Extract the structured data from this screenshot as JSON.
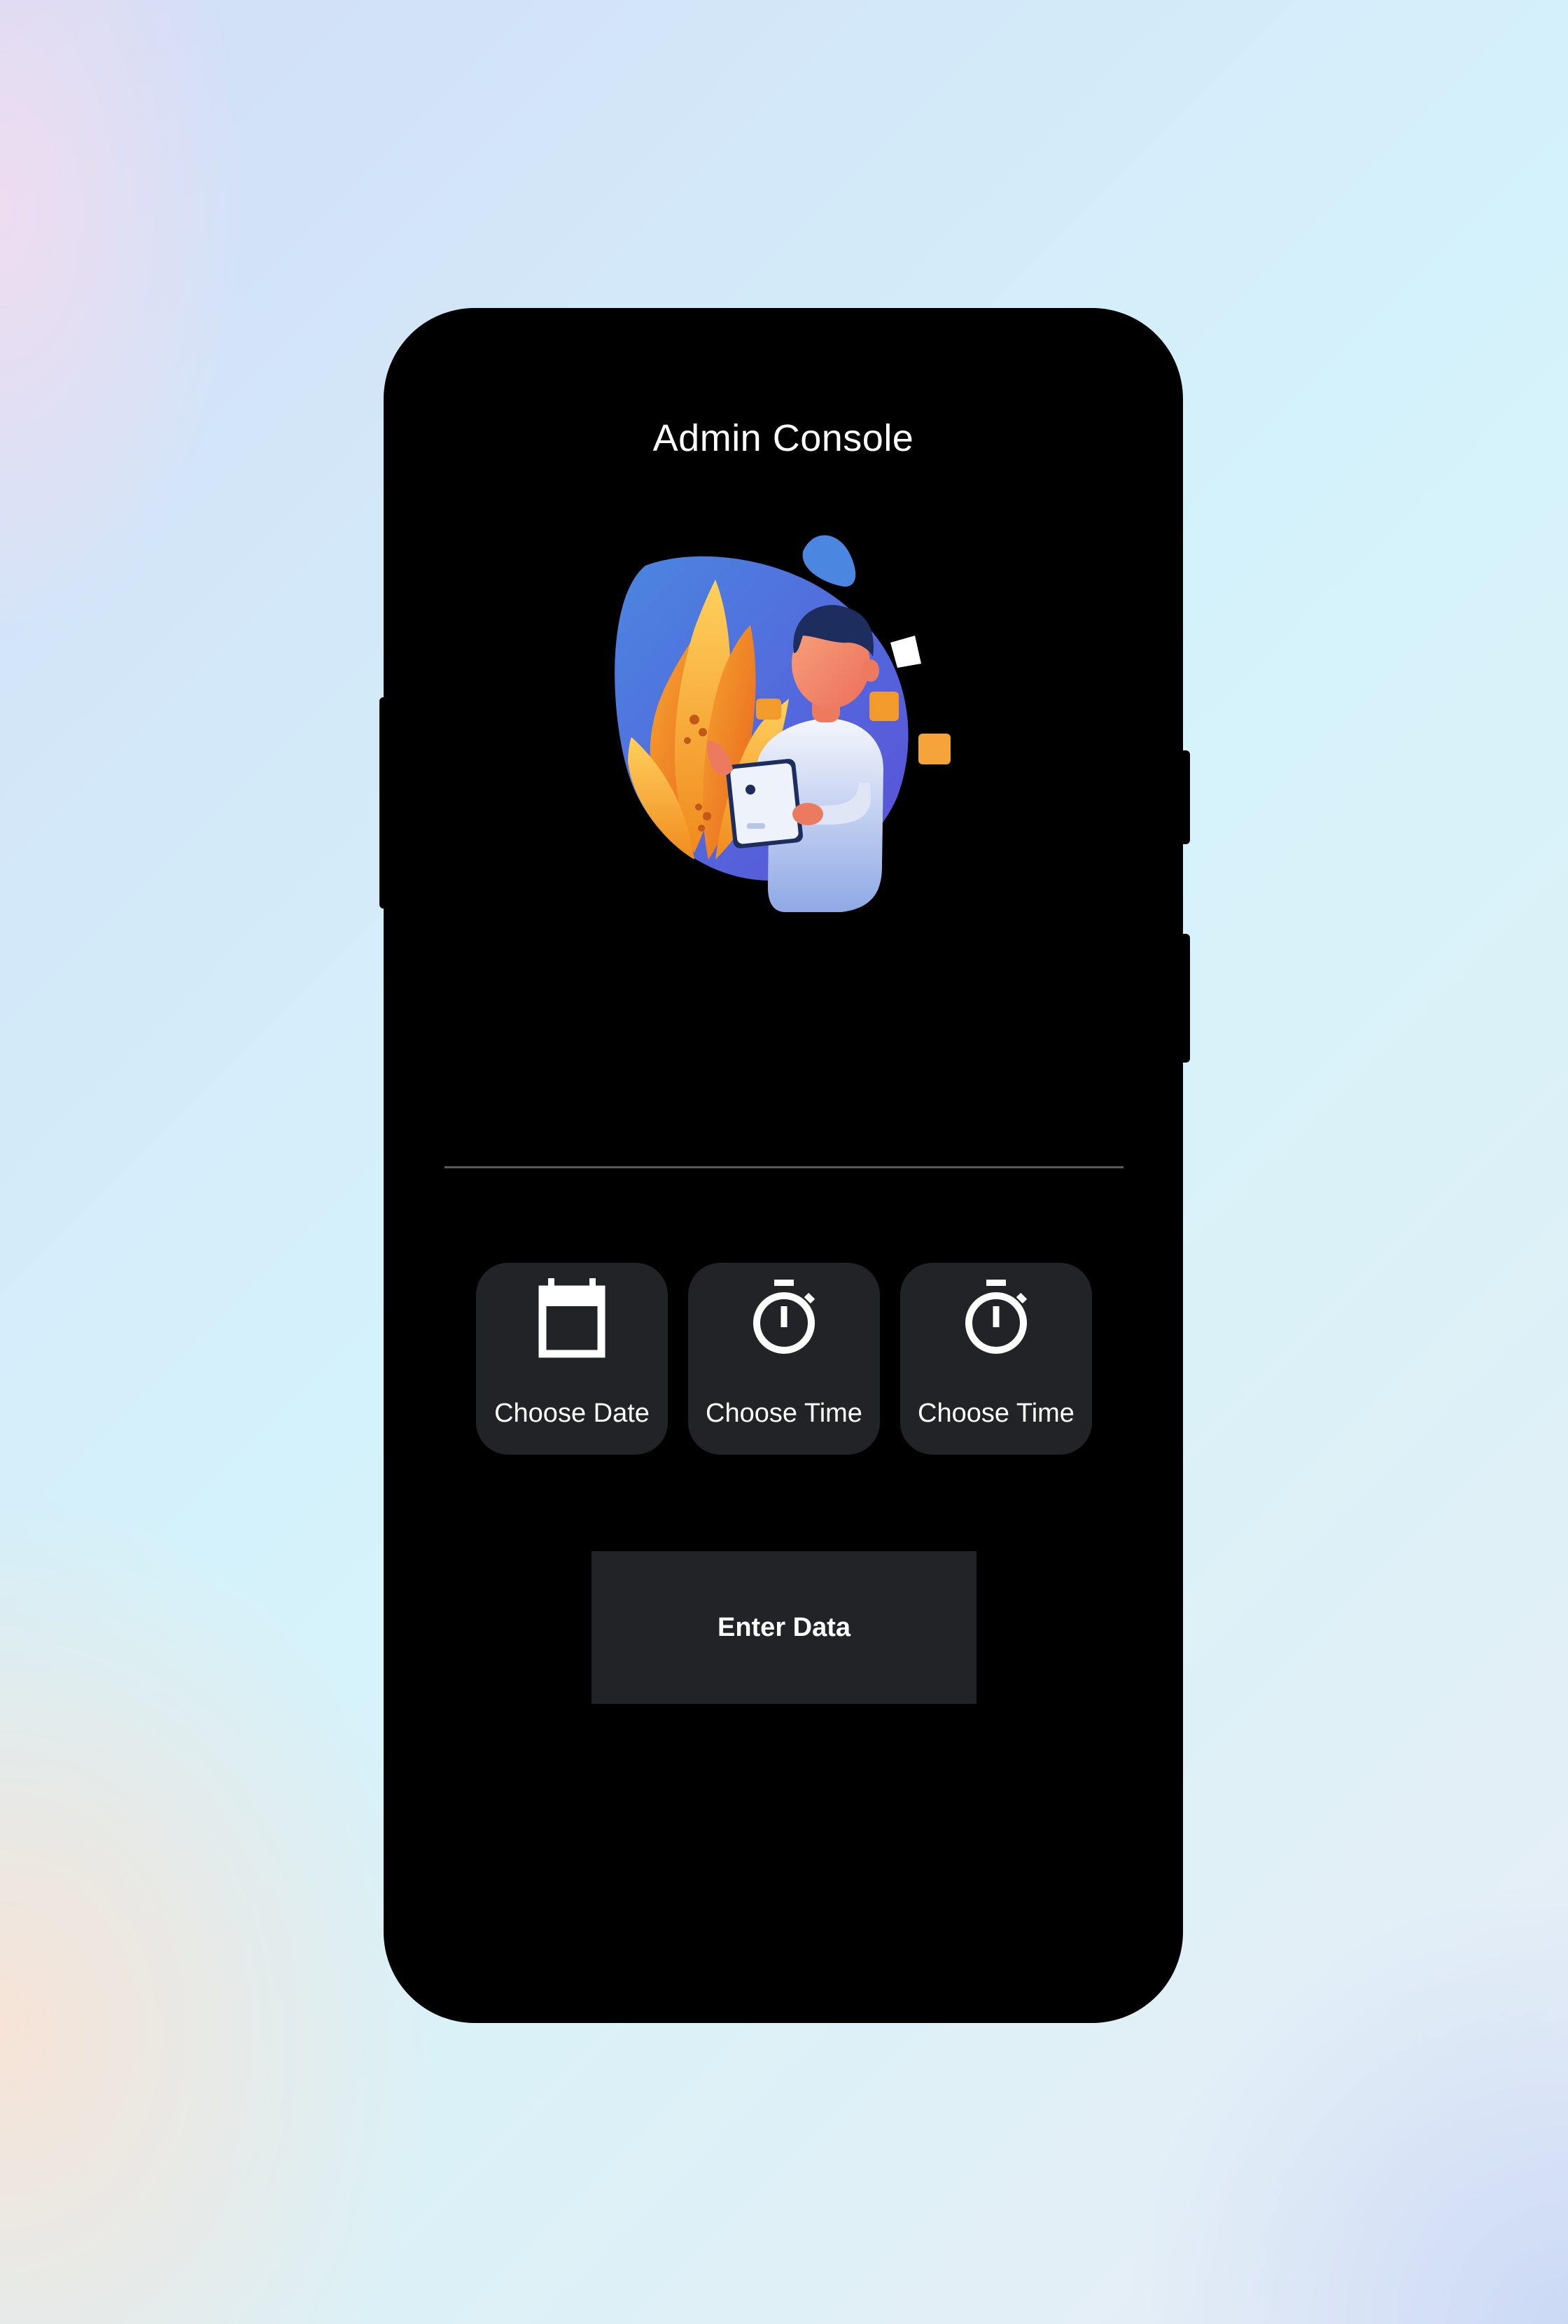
{
  "app": {
    "title": "Admin Console"
  },
  "illustration": {
    "icon": "person-with-tablet-illustration"
  },
  "actions": {
    "choose_date": {
      "label": "Choose Date",
      "icon": "calendar-icon"
    },
    "choose_time_start": {
      "label": "Choose Time",
      "icon": "stopwatch-icon"
    },
    "choose_time_end": {
      "label": "Choose Time",
      "icon": "stopwatch-icon"
    }
  },
  "submit": {
    "label": "Enter Data"
  },
  "colors": {
    "screen_background": "#000000",
    "tile_background": "#222326",
    "text": "#ffffff",
    "divider": "#5a5a5c"
  }
}
